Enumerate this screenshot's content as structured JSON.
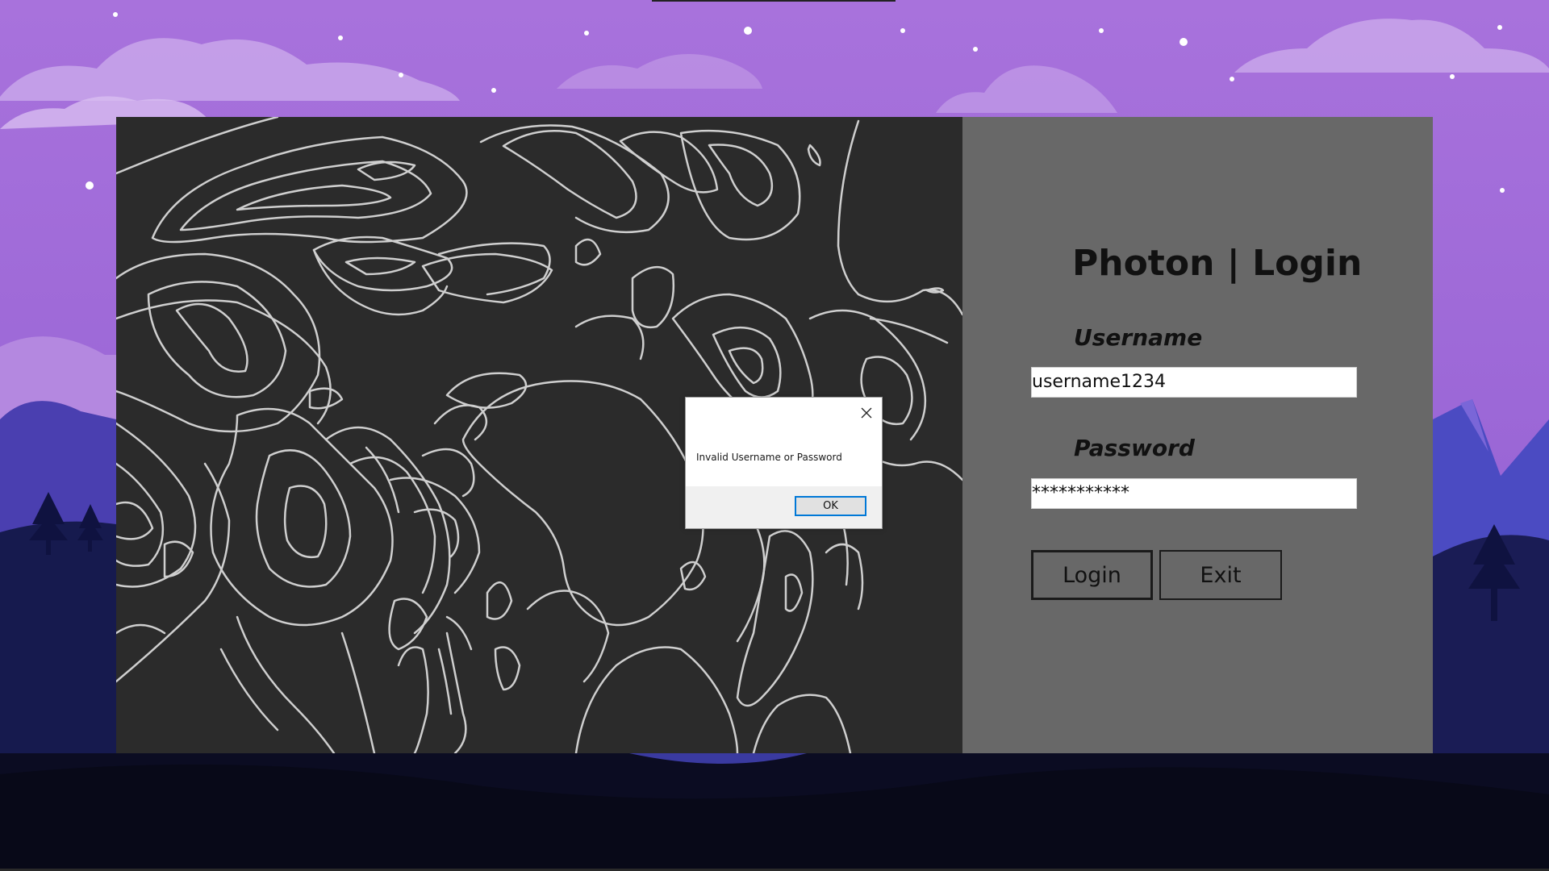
{
  "background": {
    "sky_top": "#a96fd9",
    "sky_bottom": "#8a5fd0",
    "mountain_dark": "#1b1d5a",
    "ground": "#0c0d24"
  },
  "left_panel": {
    "color": "#2b2b2b",
    "pattern_color": "#cfcfcf"
  },
  "login_form": {
    "title": "Photon | Login",
    "username_label": "Username",
    "username_value": "username1234",
    "password_label": "Password",
    "password_value": "***********",
    "login_button": "Login",
    "exit_button": "Exit",
    "panel_color": "#686868"
  },
  "message_box": {
    "text": "Invalid Username or Password",
    "ok_button": "OK",
    "close_icon": "close-icon"
  }
}
